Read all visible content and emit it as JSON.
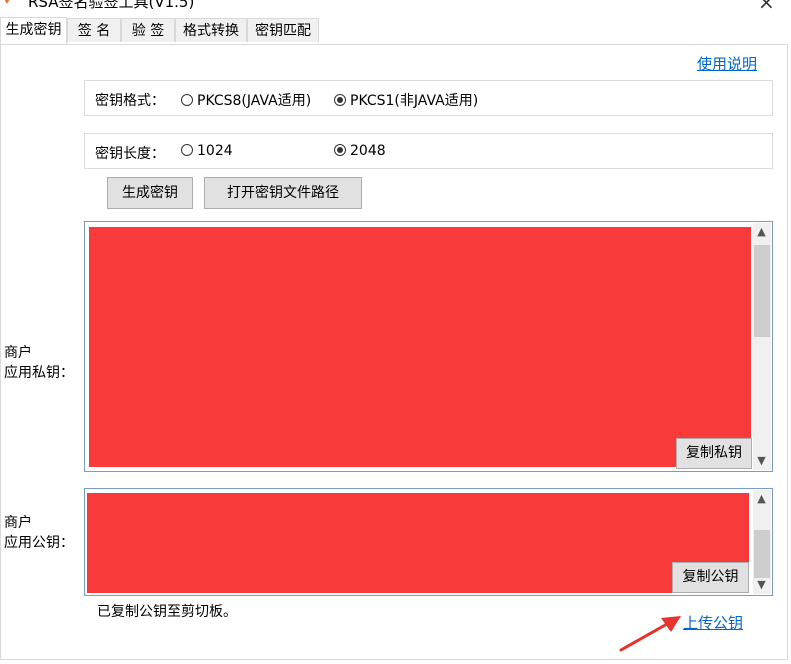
{
  "window": {
    "title": "RSA签名验签工具(V1.5)",
    "icon": "rsa-app-icon",
    "close": "×"
  },
  "tabs": [
    {
      "label": "生成密钥",
      "active": true
    },
    {
      "label": "签 名",
      "active": false
    },
    {
      "label": "验 签",
      "active": false
    },
    {
      "label": "格式转换",
      "active": false
    },
    {
      "label": "密钥匹配",
      "active": false
    }
  ],
  "help_link": "使用说明",
  "key_format": {
    "label": "密钥格式：",
    "options": [
      {
        "label": "PKCS8(JAVA适用)",
        "selected": false
      },
      {
        "label": "PKCS1(非JAVA适用)",
        "selected": true
      }
    ]
  },
  "key_length": {
    "label": "密钥长度：",
    "options": [
      {
        "label": "1024",
        "selected": false
      },
      {
        "label": "2048",
        "selected": true
      }
    ]
  },
  "buttons": {
    "generate": "生成密钥",
    "open_path": "打开密钥文件路径",
    "copy_private": "复制私钥",
    "copy_public": "复制公钥"
  },
  "private_key": {
    "label_line1": "商户",
    "label_line2": "应用私钥："
  },
  "public_key": {
    "label_line1": "商户",
    "label_line2": "应用公钥："
  },
  "status": "已复制公钥至剪切板。",
  "upload_link": "上传公钥",
  "colors": {
    "redaction": "#f83a3a",
    "link": "#0066cc",
    "annotation_arrow": "#e8322e"
  }
}
